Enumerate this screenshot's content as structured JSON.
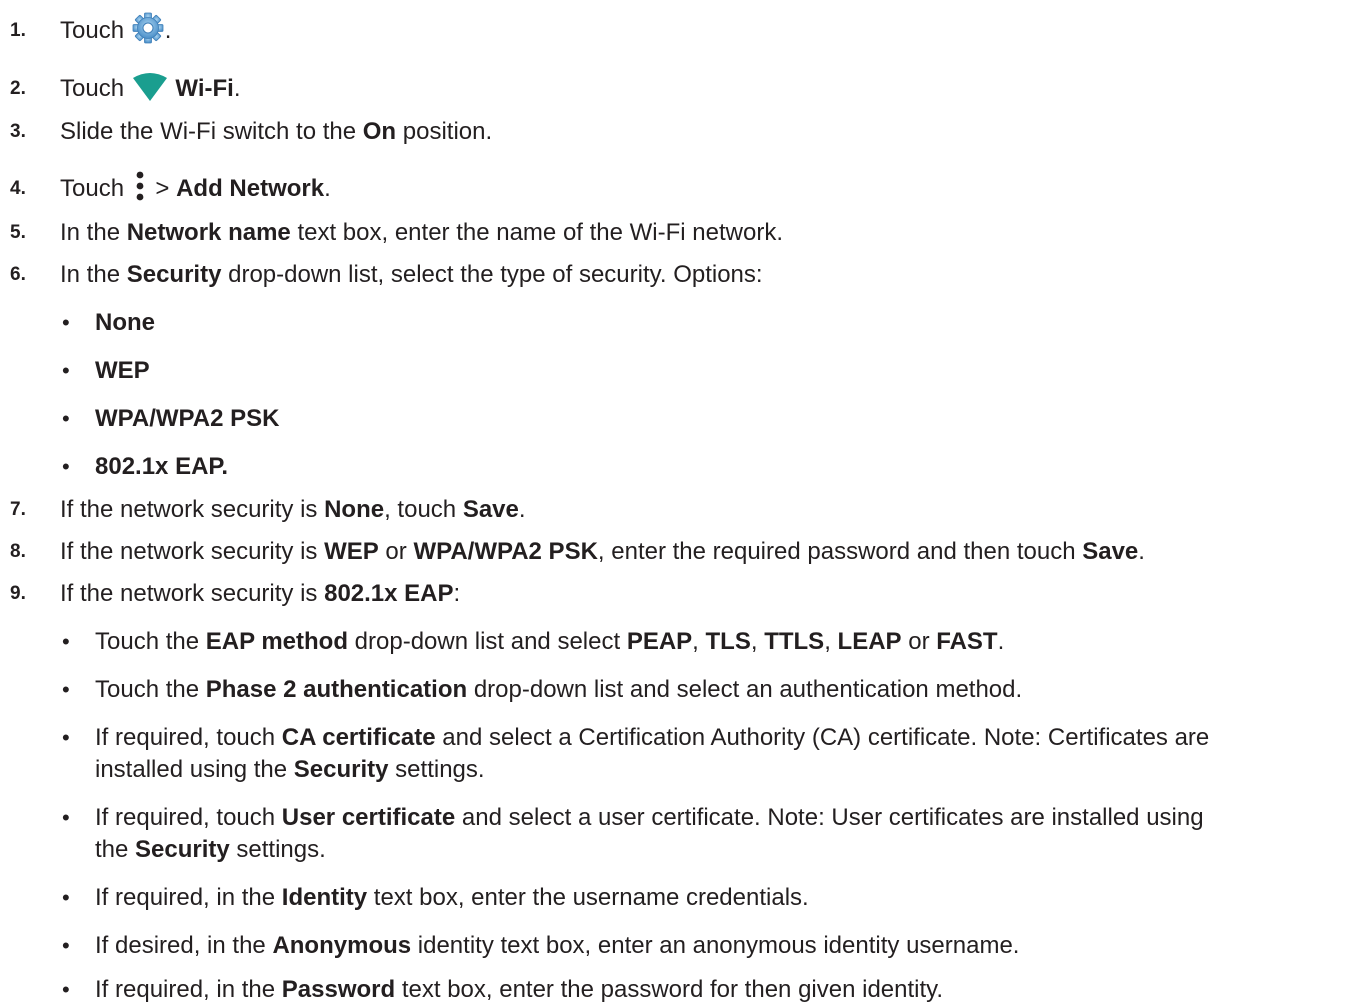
{
  "steps": [
    {
      "num": "1.",
      "parts": [
        "Touch ",
        "",
        "."
      ]
    },
    {
      "num": "2.",
      "parts": [
        "Touch ",
        "",
        " ",
        "Wi-Fi",
        "."
      ]
    },
    {
      "num": "3.",
      "parts": [
        "Slide the Wi-Fi switch to the ",
        "On",
        " position."
      ]
    },
    {
      "num": "4.",
      "parts": [
        "Touch ",
        "",
        " > ",
        "Add Network",
        "."
      ]
    },
    {
      "num": "5.",
      "parts": [
        "In the ",
        "Network name",
        " text box, enter the name of the Wi-Fi network."
      ]
    },
    {
      "num": "6.",
      "parts": [
        "In the ",
        "Security",
        " drop-down list, select the type of security. Options:"
      ]
    },
    {
      "num": "7.",
      "parts": [
        "If the network security is ",
        "None",
        ", touch ",
        "Save",
        "."
      ]
    },
    {
      "num": "8.",
      "parts": [
        "If the network security is ",
        "WEP",
        " or ",
        "WPA/WPA2 PSK",
        ", enter the required password and then touch ",
        "Save",
        "."
      ]
    },
    {
      "num": "9.",
      "parts": [
        "If the network security is ",
        "802.1x EAP",
        ":"
      ]
    }
  ],
  "security_options": [
    "None",
    "WEP",
    "WPA/WPA2 PSK",
    "802.1x EAP."
  ],
  "eap_bullets": [
    [
      "Touch the ",
      "EAP method",
      " drop-down list and select ",
      "PEAP",
      ", ",
      "TLS",
      ", ",
      "TTLS",
      ", ",
      "LEAP",
      " or ",
      "FAST",
      "."
    ],
    [
      "Touch the ",
      "Phase 2 authentication",
      " drop-down list and select an authentication method."
    ],
    [
      "If required, touch ",
      "CA certificate",
      " and select a Certification Authority (CA) certificate. Note: Certificates are"
    ],
    [
      "installed using the ",
      "Security",
      " settings."
    ],
    [
      "If required, touch ",
      "User certificate",
      " and select a user certificate. Note: User certificates are installed using"
    ],
    [
      "the ",
      "Security",
      " settings."
    ],
    [
      "If required, in the ",
      "Identity",
      " text box, enter the username credentials."
    ],
    [
      "If desired, in the ",
      "Anonymous",
      " identity text box, enter an anonymous identity username."
    ],
    [
      "If required, in the ",
      "Password",
      " text box, enter the password for then given identity."
    ]
  ],
  "bullet_char": "•",
  "icons": {
    "settings": "settings-gear-icon",
    "wifi": "wifi-icon",
    "menu": "more-vertical-menu-icon"
  },
  "colors": {
    "text": "#231f20",
    "wifi_teal": "#1a9e8f",
    "gear_blue": "#5b9fd6"
  }
}
